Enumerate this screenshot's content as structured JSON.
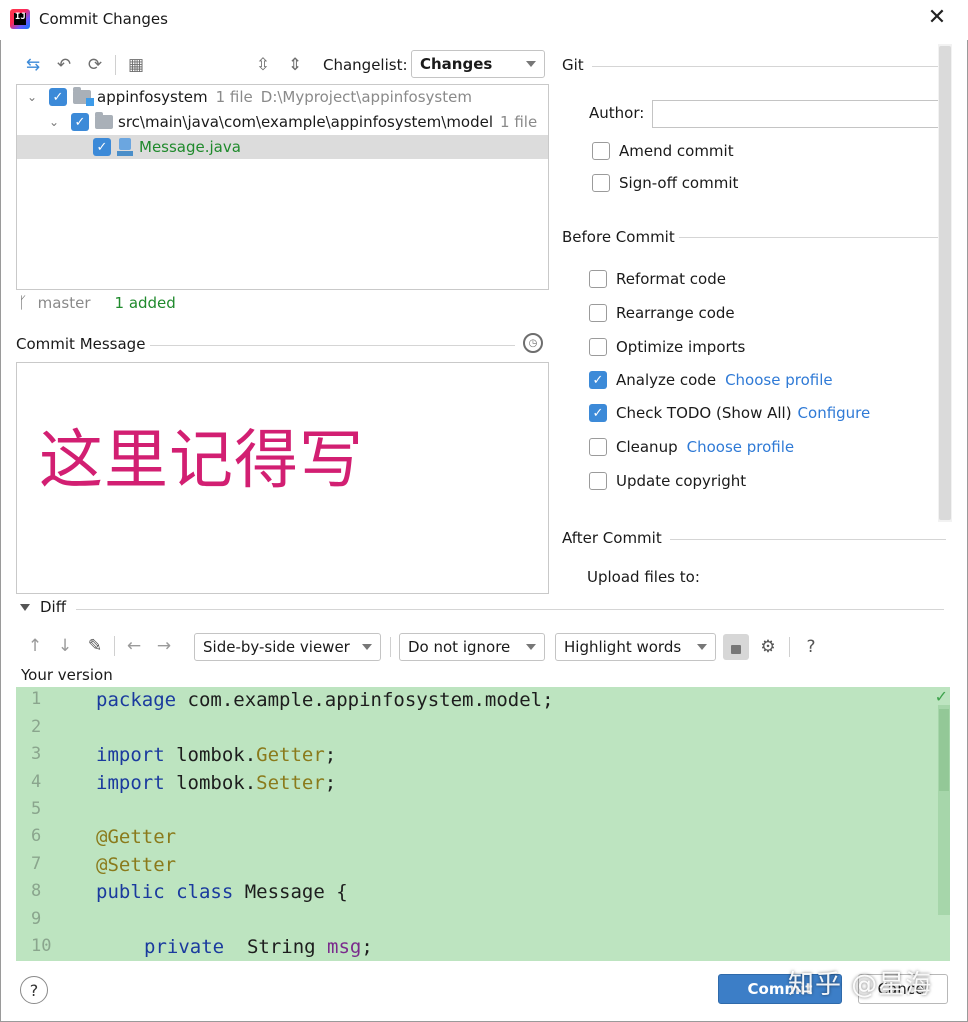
{
  "window": {
    "title": "Commit Changes"
  },
  "toolbar": {
    "changelist_label": "Changelist:",
    "changelist_value": "Changes"
  },
  "tree": {
    "root": {
      "name": "appinfosystem",
      "count": "1 file",
      "path": "D:\\Myproject\\appinfosystem"
    },
    "folder": {
      "name": "src\\main\\java\\com\\example\\appinfosystem\\model",
      "count": "1 file"
    },
    "file": {
      "name": "Message.java"
    }
  },
  "status": {
    "branch": "master",
    "added": "1 added"
  },
  "commit_message": {
    "label": "Commit Message",
    "text": "这里记得写"
  },
  "git": {
    "section": "Git",
    "author_label": "Author:",
    "author_value": "",
    "amend": "Amend commit",
    "signoff": "Sign-off commit"
  },
  "before_commit": {
    "section": "Before Commit",
    "reformat": "Reformat code",
    "rearrange": "Rearrange code",
    "optimize": "Optimize imports",
    "analyze": "Analyze code",
    "analyze_link": "Choose profile",
    "todo": "Check TODO (Show All)",
    "todo_link": "Configure",
    "cleanup": "Cleanup",
    "cleanup_link": "Choose profile",
    "copyright": "Update copyright"
  },
  "after_commit": {
    "section": "After Commit",
    "upload": "Upload files to:"
  },
  "diff": {
    "section": "Diff",
    "viewer": "Side-by-side viewer",
    "ignore": "Do not ignore",
    "highlight": "Highlight words",
    "version_label": "Your version",
    "help": "?"
  },
  "code": {
    "line_numbers": [
      "1",
      "2",
      "3",
      "4",
      "5",
      "6",
      "7",
      "8",
      "9",
      "10"
    ],
    "l1_kw": "package",
    "l1_rest": " com.example.appinfosystem.model;",
    "l3_kw": "import",
    "l3_rest": " lombok.",
    "l3_cls": "Getter",
    "l3_end": ";",
    "l4_kw": "import",
    "l4_rest": " lombok.",
    "l4_cls": "Setter",
    "l4_end": ";",
    "l6": "@Getter",
    "l7": "@Setter",
    "l8_kw": "public class",
    "l8_rest": " Message {",
    "l10_kw": "private",
    "l10_rest": "  String ",
    "l10_fld": "msg",
    "l10_end": ";"
  },
  "buttons": {
    "commit": "Commit",
    "cancel": "Cancel",
    "help": "?"
  },
  "watermark": "知乎 @星海",
  "colors": {
    "accent": "#3c8ad8",
    "code_bg": "#bde4c0",
    "message_text": "#d21f72",
    "added": "#1f8a2c"
  }
}
